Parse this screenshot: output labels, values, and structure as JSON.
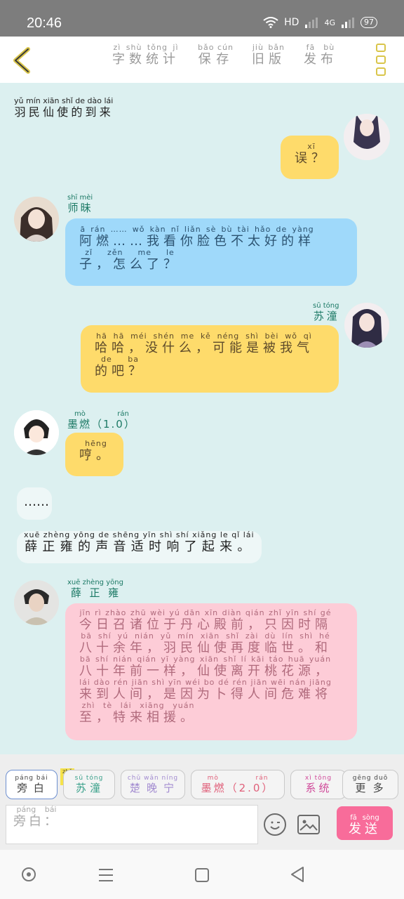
{
  "status": {
    "time": "20:46",
    "network": "HD",
    "signal": "4G",
    "battery": "97"
  },
  "header": {
    "links": [
      {
        "text": "字数统计",
        "pinyin": "zì shù tǒng jì"
      },
      {
        "text": "保存",
        "pinyin": "bǎo cún"
      },
      {
        "text": "旧版",
        "pinyin": "jiù bǎn"
      },
      {
        "text": "发布",
        "pinyin": "fā bù"
      }
    ]
  },
  "chat": {
    "title_line": {
      "text": "羽民仙使的到来",
      "pinyin": "yǔ mín xiān shǐ de dào lái"
    },
    "msg1": {
      "text": "误？",
      "pinyin": "xī"
    },
    "msg2": {
      "name": "师昧",
      "name_pinyin": "shī mèi",
      "line1": "阿燃……我看你脸色不太好的样",
      "line1_pinyin": "ā rán …… wǒ kàn nǐ liǎn sè bù tài hǎo de yàng",
      "line2": "子，怎么了？",
      "line2_pinyin": "zǐ zěn me le"
    },
    "msg3": {
      "name": "苏潼",
      "name_pinyin": "sū tóng",
      "line1": "哈哈，没什么，可能是被我气",
      "line1_pinyin": "hā hā méi shén me kě néng shì bèi wǒ qì",
      "line2": "的吧？",
      "line2_pinyin": "de ba"
    },
    "msg4": {
      "name": "墨燃（1.0）",
      "name_pinyin": "mò rán",
      "text": "哼。",
      "pinyin": "hēng"
    },
    "msg5": {
      "text": "……"
    },
    "msg6": {
      "text": "薛正雍的声音适时响了起来。",
      "pinyin": "xuē zhèng yōng de shēng yīn shì shí xiǎng le qǐ lái"
    },
    "msg7": {
      "name": "薛正雍",
      "name_pinyin": "xuē zhèng yōng",
      "lines": [
        {
          "text": "今日召诸位于丹心殿前，只因时隔",
          "pinyin": "jīn rì zhào zhū wèi yú dān xīn diàn qián zhǐ yīn shí gé"
        },
        {
          "text": "八十余年，羽民仙使再度临世。和",
          "pinyin": "bā shí yú nián yǔ mín xiān shǐ zài dù lín shì hé"
        },
        {
          "text": "八十年前一样，仙使离开桃花源，",
          "pinyin": "bā shí nián qián yī yàng xiān shǐ lí kāi táo huā yuán"
        },
        {
          "text": "来到人间，是因为卜得人间危难将",
          "pinyin": "lái dào rén jiān shì yīn wéi bo dé rén jiān wēi nán jiāng"
        },
        {
          "text": "至，特来相援。",
          "pinyin": "zhì tè lái xiāng yuán"
        }
      ]
    }
  },
  "toolbar": {
    "roles": [
      {
        "text": "旁白",
        "pinyin": "páng bái"
      },
      {
        "text": "苏潼",
        "pinyin": "sū tóng"
      },
      {
        "text": "楚晚宁",
        "pinyin": "chǔ wǎn níng"
      },
      {
        "text": "墨燃（2.0）",
        "pinyin": "mò rán"
      },
      {
        "text": "系统",
        "pinyin": "xì tǒng"
      },
      {
        "text": "更多",
        "pinyin": "gēng duō"
      }
    ],
    "main_badge": "主",
    "main_badge_pinyin": "zhǔ",
    "input_placeholder": "旁白：",
    "input_pinyin": "páng bái",
    "send_label": "发送",
    "send_pinyin": "fā sòng"
  }
}
